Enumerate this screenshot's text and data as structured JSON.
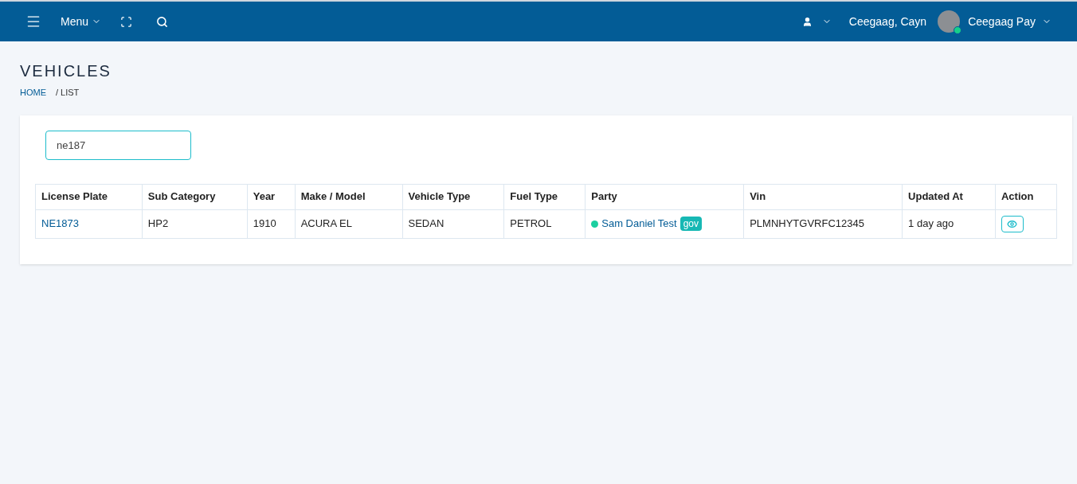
{
  "topbar": {
    "menu_label": "Menu",
    "user_name": "Ceegaag, Cayn",
    "account_name": "Ceegaag Pay"
  },
  "page": {
    "title": "VEHICLES",
    "breadcrumb": [
      {
        "label": "HOME",
        "link": true
      },
      {
        "label": "/ LIST",
        "link": false
      }
    ]
  },
  "search": {
    "value": "ne187"
  },
  "table": {
    "columns": [
      "License Plate",
      "Sub Category",
      "Year",
      "Make / Model",
      "Vehicle Type",
      "Fuel Type",
      "Party",
      "Vin",
      "Updated At",
      "Action"
    ],
    "rows": [
      {
        "license_plate": "NE1873",
        "sub_category": "HP2",
        "year": "1910",
        "make_model": "ACURA EL",
        "vehicle_type": "SEDAN",
        "fuel_type": "PETROL",
        "party": {
          "name": "Sam Daniel Test",
          "color": "#1bcfa0",
          "badge": "gov"
        },
        "vin": "PLMNHYTGVRFC12345",
        "updated_at": "1 day ago"
      }
    ]
  }
}
